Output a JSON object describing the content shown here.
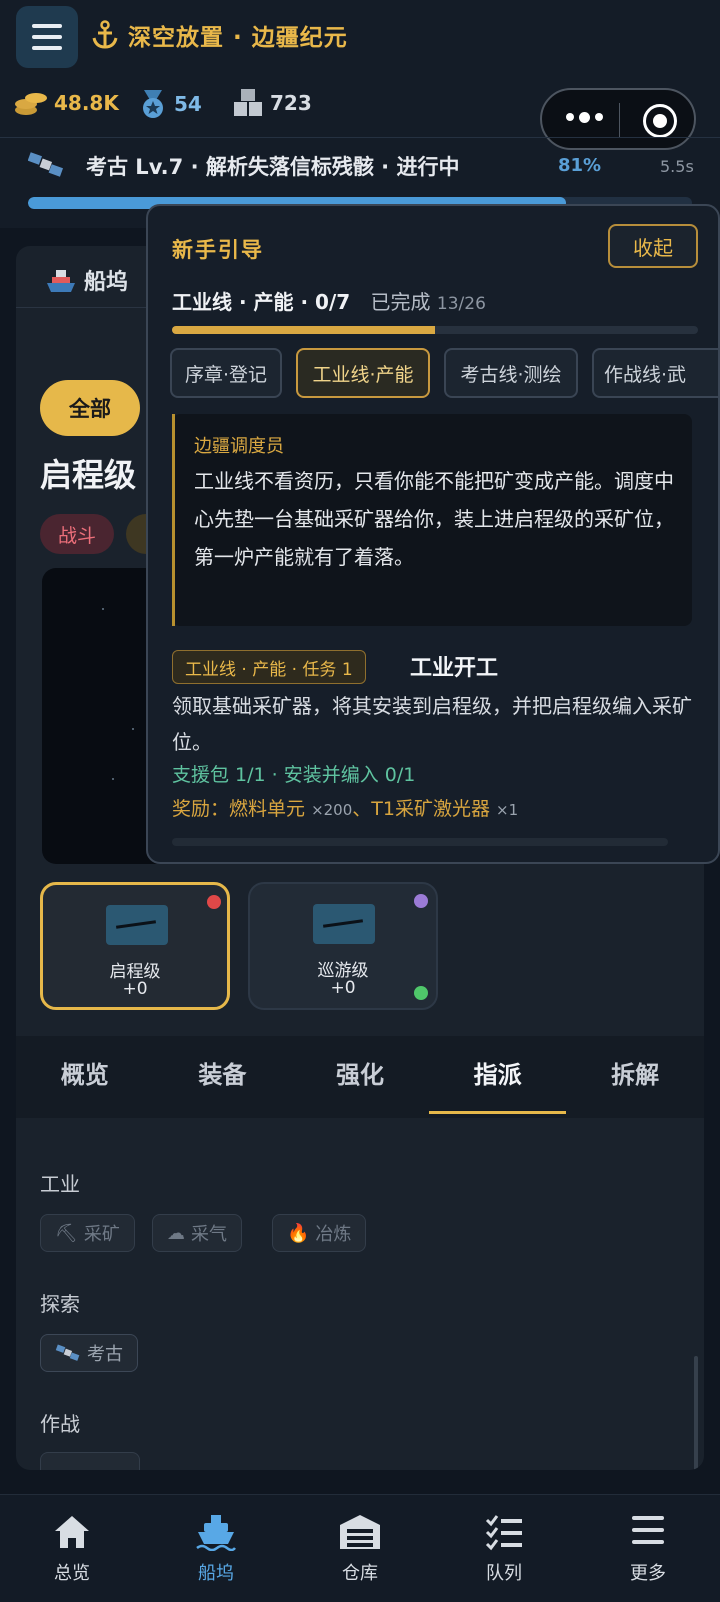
{
  "header": {
    "app_title": "深空放置 · 边疆纪元",
    "resources": [
      {
        "icon": "coins-icon",
        "value": "48.8K"
      },
      {
        "icon": "medal-icon",
        "value": "54"
      },
      {
        "icon": "crates-icon",
        "value": "723"
      }
    ]
  },
  "task": {
    "text": "考古 Lv.7 · 解析失落信标残骸 · 进行中",
    "percent": "81%",
    "progress": 0.81,
    "time": "5.5s"
  },
  "dock": {
    "title": "船坞",
    "filter_all": "全部",
    "ship_name": "启程级",
    "tag_battle": "战斗",
    "ships": [
      {
        "name": "启程级",
        "level": "+0"
      },
      {
        "name": "巡游级",
        "level": "+0"
      }
    ],
    "tabs": [
      "概览",
      "装备",
      "强化",
      "指派",
      "拆解"
    ],
    "active_tab": "指派",
    "sections": {
      "industry": {
        "label": "工业",
        "chips": [
          {
            "icon": "pickaxe-icon",
            "glyph": "⛏",
            "label": "采矿"
          },
          {
            "icon": "cloud-icon",
            "glyph": "☁",
            "label": "采气"
          },
          {
            "icon": "fire-icon",
            "glyph": "🔥",
            "label": "冶炼"
          }
        ]
      },
      "explore": {
        "label": "探索",
        "chips": [
          {
            "icon": "satellite-icon",
            "label": "考古"
          }
        ]
      },
      "combat": {
        "label": "作战"
      }
    }
  },
  "guide": {
    "title": "新手引导",
    "collapse": "收起",
    "line_name": "工业线 · 产能 · 0/7",
    "done_label": "已完成",
    "done_count": "13/26",
    "line_progress": 0.5,
    "tabs": [
      "序章·登记",
      "工业线·产能",
      "考古线·测绘",
      "作战线·武"
    ],
    "speaker": "边疆调度员",
    "message": "工业线不看资历，只看你能不能把矿变成产能。调度中心先垫一台基础采矿器给你，装上进启程级的采矿位，第一炉产能就有了着落。",
    "task_tag": "工业线 · 产能 · 任务 1",
    "task_title": "工业开工",
    "task_desc": "领取基础采矿器，将其安装到启程级，并把启程级编入采矿位。",
    "task_progress": "支援包 1/1 · 安装并编入 0/1",
    "reward_label": "奖励：燃料单元",
    "reward_mult_1": "×200",
    "reward_sep": "、T1采矿激光器",
    "reward_mult_2": "×1"
  },
  "nav": [
    {
      "icon": "home-icon",
      "label": "总览"
    },
    {
      "icon": "dock-ship-icon",
      "label": "船坞"
    },
    {
      "icon": "warehouse-icon",
      "label": "仓库"
    },
    {
      "icon": "queue-icon",
      "label": "队列"
    },
    {
      "icon": "more-icon",
      "label": "更多"
    }
  ],
  "colors": {
    "accent_gold": "#e9b84a",
    "accent_blue": "#58a8e6",
    "battle_red": "#ec6f7a",
    "progress_green": "#5fc3a0"
  }
}
